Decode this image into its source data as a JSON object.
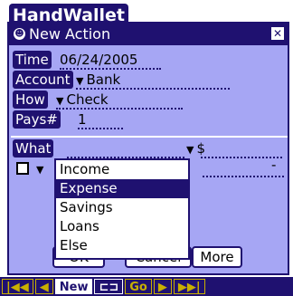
{
  "app": {
    "title": "HandWallet"
  },
  "dialog": {
    "title": "New Action",
    "fields": {
      "time": {
        "label": "Time",
        "value": "06/24/2005"
      },
      "account": {
        "label": "Account",
        "value": "Bank"
      },
      "how": {
        "label": "How",
        "value": "Check"
      },
      "pays": {
        "label": "Pays#",
        "value": "1"
      },
      "what": {
        "label": "What",
        "currency": "$"
      }
    },
    "amount_placeholder": "-",
    "popup": {
      "items": [
        "Income",
        "Expense",
        "Savings",
        "Loans",
        "Else"
      ],
      "selected": "Expense"
    },
    "buttons": {
      "ok": "OK",
      "cancel": "Cancel",
      "more": "More"
    }
  },
  "toolbar": {
    "first": "|◀◀",
    "prev": "◀",
    "new": "New",
    "key": "⊏⊐",
    "go": "Go",
    "next": "▶",
    "last": "▶▶|"
  },
  "colors": {
    "navy": "#1f1170",
    "lavender": "#a6a6f4",
    "gold": "#c8b000"
  }
}
